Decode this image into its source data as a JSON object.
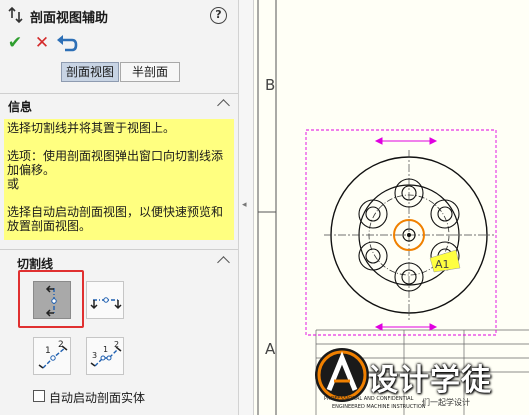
{
  "panel": {
    "title": "剖面视图辅助",
    "help_icon": "?",
    "actions": {
      "ok_icon": "✔",
      "cancel_icon": "✕",
      "undo_icon": "undo-icon"
    },
    "tabs": [
      {
        "label": "剖面视图",
        "selected": true
      },
      {
        "label": "半剖面",
        "selected": false
      }
    ],
    "info_section": {
      "label": "信息",
      "lines": [
        "选择切割线并将其置于视图上。",
        "选项：使用剖面视图弹出窗口向切割线添加偏移。",
        "或",
        "选择自动启动剖面视图，以便快速预览和放置剖面视图。"
      ]
    },
    "cutline_section": {
      "label": "切割线",
      "buttons": [
        {
          "name": "vertical-cutline",
          "selected": true
        },
        {
          "name": "horizontal-cutline",
          "selected": false
        },
        {
          "name": "aligned-cutline",
          "selected": false
        },
        {
          "name": "auxiliary-cutline",
          "selected": false
        }
      ]
    },
    "auto_start_checkbox": {
      "label": "自动启动剖面实体",
      "checked": false
    }
  },
  "sheet": {
    "zone_b": "B",
    "zone_a": "A",
    "view_label": "A1",
    "watermark": {
      "text": "设计学徒",
      "sub": "们一起学设计",
      "fine1": "PROFESSIONAL AND CONFIDENTIAL",
      "fine2": "ENGINEERED MACHINE INSTRUCTION"
    }
  },
  "colors": {
    "accent_magenta": "#e000e0",
    "hole_orange": "#f08000",
    "info_bg": "#ffff80",
    "selected_red_frame": "#e03030",
    "ok_green": "#2f9e2f",
    "cancel_red": "#d42a2a"
  }
}
